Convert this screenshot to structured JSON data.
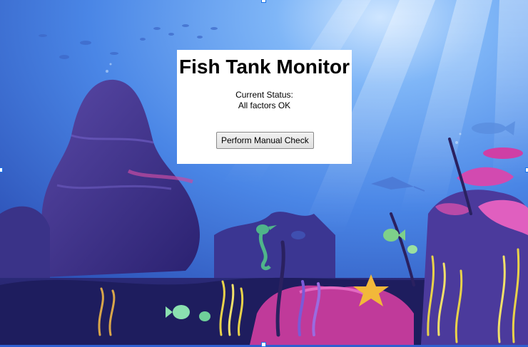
{
  "monitor": {
    "title": "Fish Tank Monitor",
    "status_caption": "Current Status:",
    "status_text": "All factors OK",
    "check_button_label": "Perform Manual Check"
  },
  "background": {
    "scene": "underwater-reef-illustration",
    "colors": {
      "water_light": "#5f9ff2",
      "water_deep": "#2a3fb0",
      "rock": "#4a3a8c",
      "coral_pink": "#c13aa0",
      "starfish": "#f2b83a",
      "seaweed_yellow": "#e8d24a"
    }
  },
  "selection_handles": [
    "top-center",
    "left-middle",
    "right-middle",
    "bottom-center"
  ]
}
